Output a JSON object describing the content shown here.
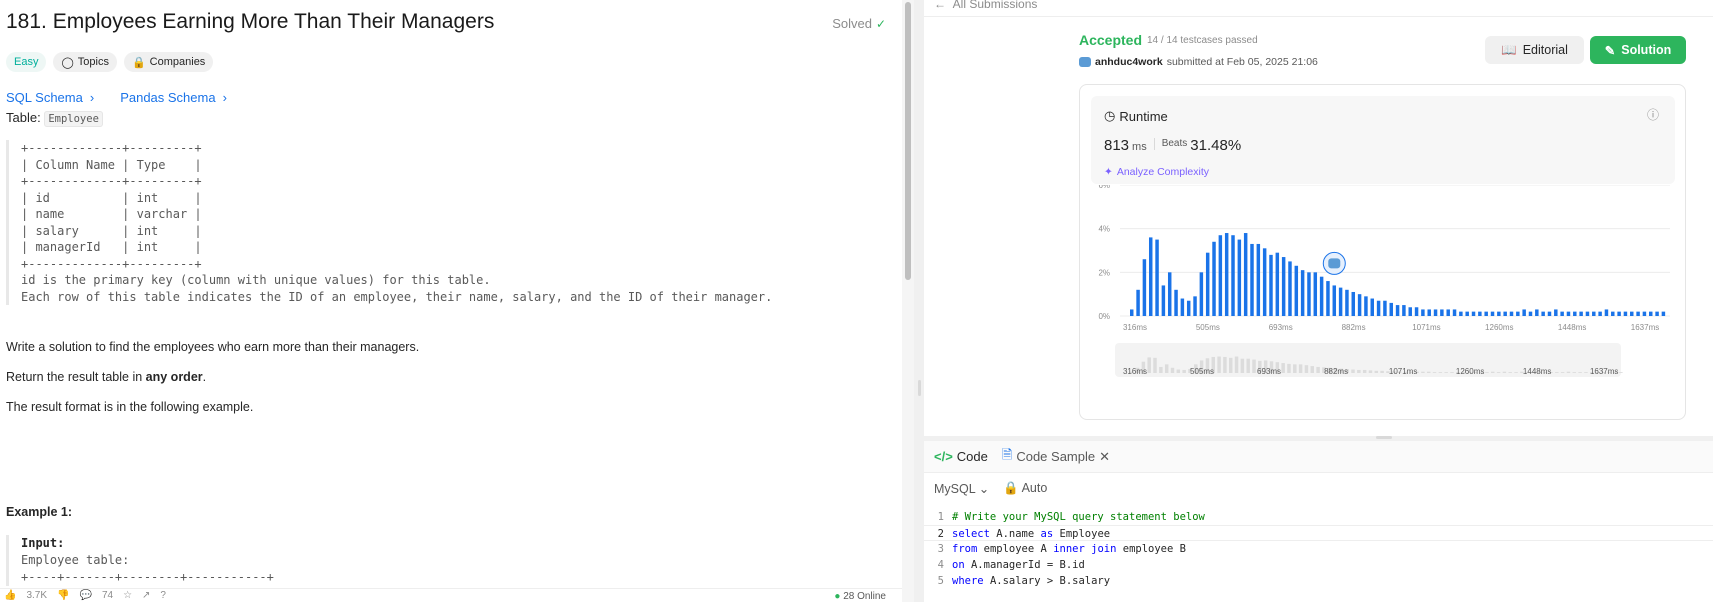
{
  "problem": {
    "title": "181. Employees Earning More Than Their Managers",
    "status": "Solved",
    "tags": [
      "Easy",
      "Topics",
      "Companies"
    ],
    "schema_links": [
      "SQL Schema",
      "Pandas Schema"
    ],
    "table_prefix": "Table:",
    "table_name": "Employee",
    "schema_block": "+-------------+---------+\n| Column Name | Type    |\n+-------------+---------+\n| id          | int     |\n| name        | varchar |\n| salary      | int     |\n| managerId   | int     |\n+-------------+---------+\nid is the primary key (column with unique values) for this table.\nEach row of this table indicates the ID of an employee, their name, salary, and the ID of their manager.",
    "para1": "Write a solution to find the employees who earn more than their managers.",
    "para2_pre": "Return the result table in ",
    "para2_bold": "any order",
    "para2_post": ".",
    "para3": "The result format is in the following example.",
    "example_title": "Example 1:",
    "example_input_label": "Input:",
    "example_lines": "Employee table:\n+----+-------+--------+-----------+",
    "footer": {
      "likes": "3.7K",
      "comments": "74",
      "online": "28 Online"
    }
  },
  "submission": {
    "back_link": "All Submissions",
    "status": "Accepted",
    "testcases": "14 / 14 testcases passed",
    "user": "anhduc4work",
    "submitted_at": "submitted at Feb 05, 2025 21:06",
    "editorial_label": "Editorial",
    "solution_label": "Solution",
    "runtime_label": "Runtime",
    "runtime_value": "813",
    "runtime_unit": "ms",
    "beats_label": "Beats",
    "beats_value": "31.48%",
    "analyze_label": "Analyze Complexity"
  },
  "chart_data": {
    "type": "bar",
    "xlabel": "",
    "ylabel": "",
    "y_ticks": [
      "6%",
      "4%",
      "2%",
      "0%"
    ],
    "x_ticks": [
      "316ms",
      "505ms",
      "693ms",
      "882ms",
      "1071ms",
      "1260ms",
      "1448ms",
      "1637ms"
    ],
    "ylim": [
      0,
      6
    ],
    "bar_color": "#1a73e8",
    "highlight_index": 32,
    "values": [
      0.3,
      1.2,
      2.6,
      3.6,
      3.5,
      1.4,
      2.0,
      1.2,
      0.8,
      0.7,
      0.9,
      2.0,
      2.9,
      3.4,
      3.7,
      3.8,
      3.7,
      3.5,
      3.8,
      3.3,
      3.3,
      3.1,
      2.8,
      2.9,
      2.7,
      2.5,
      2.3,
      2.1,
      2.0,
      2.0,
      1.8,
      1.6,
      1.4,
      1.3,
      1.2,
      1.1,
      1.0,
      0.9,
      0.8,
      0.7,
      0.7,
      0.6,
      0.5,
      0.5,
      0.4,
      0.4,
      0.3,
      0.3,
      0.3,
      0.3,
      0.3,
      0.3,
      0.2,
      0.2,
      0.2,
      0.2,
      0.2,
      0.2,
      0.2,
      0.2,
      0.2,
      0.2,
      0.3,
      0.2,
      0.3,
      0.2,
      0.2,
      0.3,
      0.2,
      0.2,
      0.2,
      0.2,
      0.2,
      0.2,
      0.2,
      0.3,
      0.2,
      0.2,
      0.2,
      0.2,
      0.2,
      0.2,
      0.2,
      0.2,
      0.2
    ]
  },
  "code_panel": {
    "tab_code": "Code",
    "tab_sample": "Code Sample",
    "language": "MySQL",
    "mode": "Auto",
    "lines": [
      {
        "n": "1",
        "text": "# Write your MySQL query statement below"
      },
      {
        "n": "2",
        "text": "select A.name as Employee"
      },
      {
        "n": "3",
        "text": "from employee A inner join employee B"
      },
      {
        "n": "4",
        "text": "on A.managerId = B.id"
      },
      {
        "n": "5",
        "text": "where A.salary > B.salary"
      }
    ]
  }
}
